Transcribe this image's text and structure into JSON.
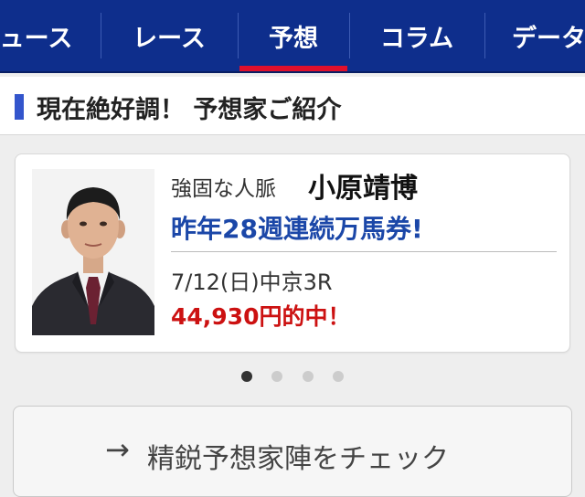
{
  "nav": {
    "tabs": [
      {
        "label": "ニュース"
      },
      {
        "label": "レース"
      },
      {
        "label": "予想"
      },
      {
        "label": "コラム"
      },
      {
        "label": "データ"
      }
    ],
    "active_tab": "予想"
  },
  "section": {
    "title": "現在絶好調！ 予想家ご紹介"
  },
  "card": {
    "catchphrase": "強固な人脈",
    "name": "小原靖博",
    "headline": "昨年28週連続万馬券!",
    "race": "7/12(日)中京3R",
    "payout": "44,930円的中！"
  },
  "carousel": {
    "page_count": 4,
    "active_index": 0
  },
  "check_button": {
    "arrow": "→",
    "label": "精鋭予想家陣をチェック"
  },
  "colors": {
    "nav_bg": "#0e2e8c",
    "active_indicator": "#e0102c",
    "section_accent": "#3355cc",
    "headline": "#1b47a8",
    "payout": "#cc1111"
  }
}
